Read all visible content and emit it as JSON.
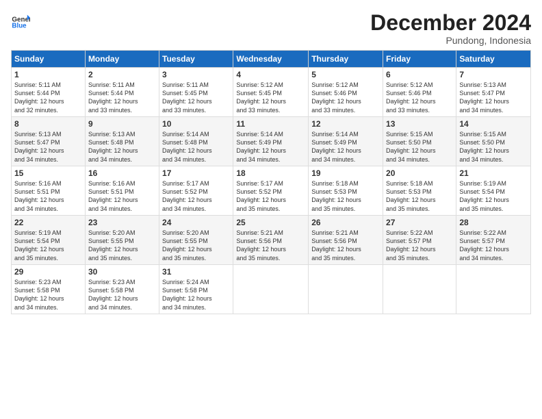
{
  "header": {
    "logo_general": "General",
    "logo_blue": "Blue",
    "month_year": "December 2024",
    "location": "Pundong, Indonesia"
  },
  "weekdays": [
    "Sunday",
    "Monday",
    "Tuesday",
    "Wednesday",
    "Thursday",
    "Friday",
    "Saturday"
  ],
  "weeks": [
    [
      {
        "day": "1",
        "sunrise": "5:11 AM",
        "sunset": "5:44 PM",
        "daylight": "12 hours and 32 minutes."
      },
      {
        "day": "2",
        "sunrise": "5:11 AM",
        "sunset": "5:44 PM",
        "daylight": "12 hours and 33 minutes."
      },
      {
        "day": "3",
        "sunrise": "5:11 AM",
        "sunset": "5:45 PM",
        "daylight": "12 hours and 33 minutes."
      },
      {
        "day": "4",
        "sunrise": "5:12 AM",
        "sunset": "5:45 PM",
        "daylight": "12 hours and 33 minutes."
      },
      {
        "day": "5",
        "sunrise": "5:12 AM",
        "sunset": "5:46 PM",
        "daylight": "12 hours and 33 minutes."
      },
      {
        "day": "6",
        "sunrise": "5:12 AM",
        "sunset": "5:46 PM",
        "daylight": "12 hours and 33 minutes."
      },
      {
        "day": "7",
        "sunrise": "5:13 AM",
        "sunset": "5:47 PM",
        "daylight": "12 hours and 34 minutes."
      }
    ],
    [
      {
        "day": "8",
        "sunrise": "5:13 AM",
        "sunset": "5:47 PM",
        "daylight": "12 hours and 34 minutes."
      },
      {
        "day": "9",
        "sunrise": "5:13 AM",
        "sunset": "5:48 PM",
        "daylight": "12 hours and 34 minutes."
      },
      {
        "day": "10",
        "sunrise": "5:14 AM",
        "sunset": "5:48 PM",
        "daylight": "12 hours and 34 minutes."
      },
      {
        "day": "11",
        "sunrise": "5:14 AM",
        "sunset": "5:49 PM",
        "daylight": "12 hours and 34 minutes."
      },
      {
        "day": "12",
        "sunrise": "5:14 AM",
        "sunset": "5:49 PM",
        "daylight": "12 hours and 34 minutes."
      },
      {
        "day": "13",
        "sunrise": "5:15 AM",
        "sunset": "5:50 PM",
        "daylight": "12 hours and 34 minutes."
      },
      {
        "day": "14",
        "sunrise": "5:15 AM",
        "sunset": "5:50 PM",
        "daylight": "12 hours and 34 minutes."
      }
    ],
    [
      {
        "day": "15",
        "sunrise": "5:16 AM",
        "sunset": "5:51 PM",
        "daylight": "12 hours and 34 minutes."
      },
      {
        "day": "16",
        "sunrise": "5:16 AM",
        "sunset": "5:51 PM",
        "daylight": "12 hours and 34 minutes."
      },
      {
        "day": "17",
        "sunrise": "5:17 AM",
        "sunset": "5:52 PM",
        "daylight": "12 hours and 34 minutes."
      },
      {
        "day": "18",
        "sunrise": "5:17 AM",
        "sunset": "5:52 PM",
        "daylight": "12 hours and 35 minutes."
      },
      {
        "day": "19",
        "sunrise": "5:18 AM",
        "sunset": "5:53 PM",
        "daylight": "12 hours and 35 minutes."
      },
      {
        "day": "20",
        "sunrise": "5:18 AM",
        "sunset": "5:53 PM",
        "daylight": "12 hours and 35 minutes."
      },
      {
        "day": "21",
        "sunrise": "5:19 AM",
        "sunset": "5:54 PM",
        "daylight": "12 hours and 35 minutes."
      }
    ],
    [
      {
        "day": "22",
        "sunrise": "5:19 AM",
        "sunset": "5:54 PM",
        "daylight": "12 hours and 35 minutes."
      },
      {
        "day": "23",
        "sunrise": "5:20 AM",
        "sunset": "5:55 PM",
        "daylight": "12 hours and 35 minutes."
      },
      {
        "day": "24",
        "sunrise": "5:20 AM",
        "sunset": "5:55 PM",
        "daylight": "12 hours and 35 minutes."
      },
      {
        "day": "25",
        "sunrise": "5:21 AM",
        "sunset": "5:56 PM",
        "daylight": "12 hours and 35 minutes."
      },
      {
        "day": "26",
        "sunrise": "5:21 AM",
        "sunset": "5:56 PM",
        "daylight": "12 hours and 35 minutes."
      },
      {
        "day": "27",
        "sunrise": "5:22 AM",
        "sunset": "5:57 PM",
        "daylight": "12 hours and 35 minutes."
      },
      {
        "day": "28",
        "sunrise": "5:22 AM",
        "sunset": "5:57 PM",
        "daylight": "12 hours and 34 minutes."
      }
    ],
    [
      {
        "day": "29",
        "sunrise": "5:23 AM",
        "sunset": "5:58 PM",
        "daylight": "12 hours and 34 minutes."
      },
      {
        "day": "30",
        "sunrise": "5:23 AM",
        "sunset": "5:58 PM",
        "daylight": "12 hours and 34 minutes."
      },
      {
        "day": "31",
        "sunrise": "5:24 AM",
        "sunset": "5:58 PM",
        "daylight": "12 hours and 34 minutes."
      },
      null,
      null,
      null,
      null
    ]
  ]
}
